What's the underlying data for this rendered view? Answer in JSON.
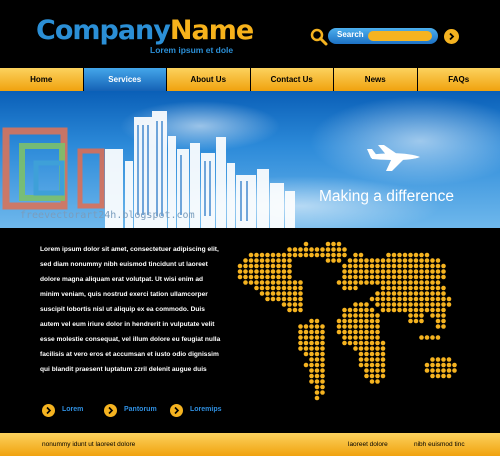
{
  "brand": {
    "company": "Company",
    "name": "Name",
    "tagline": "Lorem ipsum et dole"
  },
  "search": {
    "label": "Search",
    "value": ""
  },
  "nav": {
    "items": [
      "Home",
      "Services",
      "About Us",
      "Contact Us",
      "News",
      "FAQs"
    ],
    "active": "Services"
  },
  "banner": {
    "headline": "Making a difference",
    "watermark": "freevectorart24h.blogspot.com"
  },
  "content": {
    "paragraph_lines": [
      "Lorem ipsum dolor sit amet, consectetuer adipiscing elit,",
      "sed diam nonummy nibh euismod tincidunt ut laoreet",
      "dolore magna aliquam erat volutpat. Ut wisi enim ad",
      "minim veniam, quis nostrud exerci tation ullamcorper",
      "suscipit lobortis nisl ut aliquip ex ea commodo. Duis",
      "autem vel eum iriure dolor in hendrerit in vulputate velit",
      "esse molestie consequat, vel illum dolore eu feugiat nulla",
      "facilisis at vero eros et accumsan et iusto odio dignissim",
      "qui blandit praesent luptatum zzril delenit augue duis"
    ],
    "links": [
      "Lorem",
      "Pantorum",
      "Loremips"
    ]
  },
  "footer": {
    "left": "nonummy idunt ut laoreet dolore",
    "middle": "laoreet dolore",
    "right": "nibh euismod tinc"
  },
  "colors": {
    "accent_orange": "#f5b320",
    "accent_blue": "#2b8fd6",
    "background": "#000000"
  }
}
